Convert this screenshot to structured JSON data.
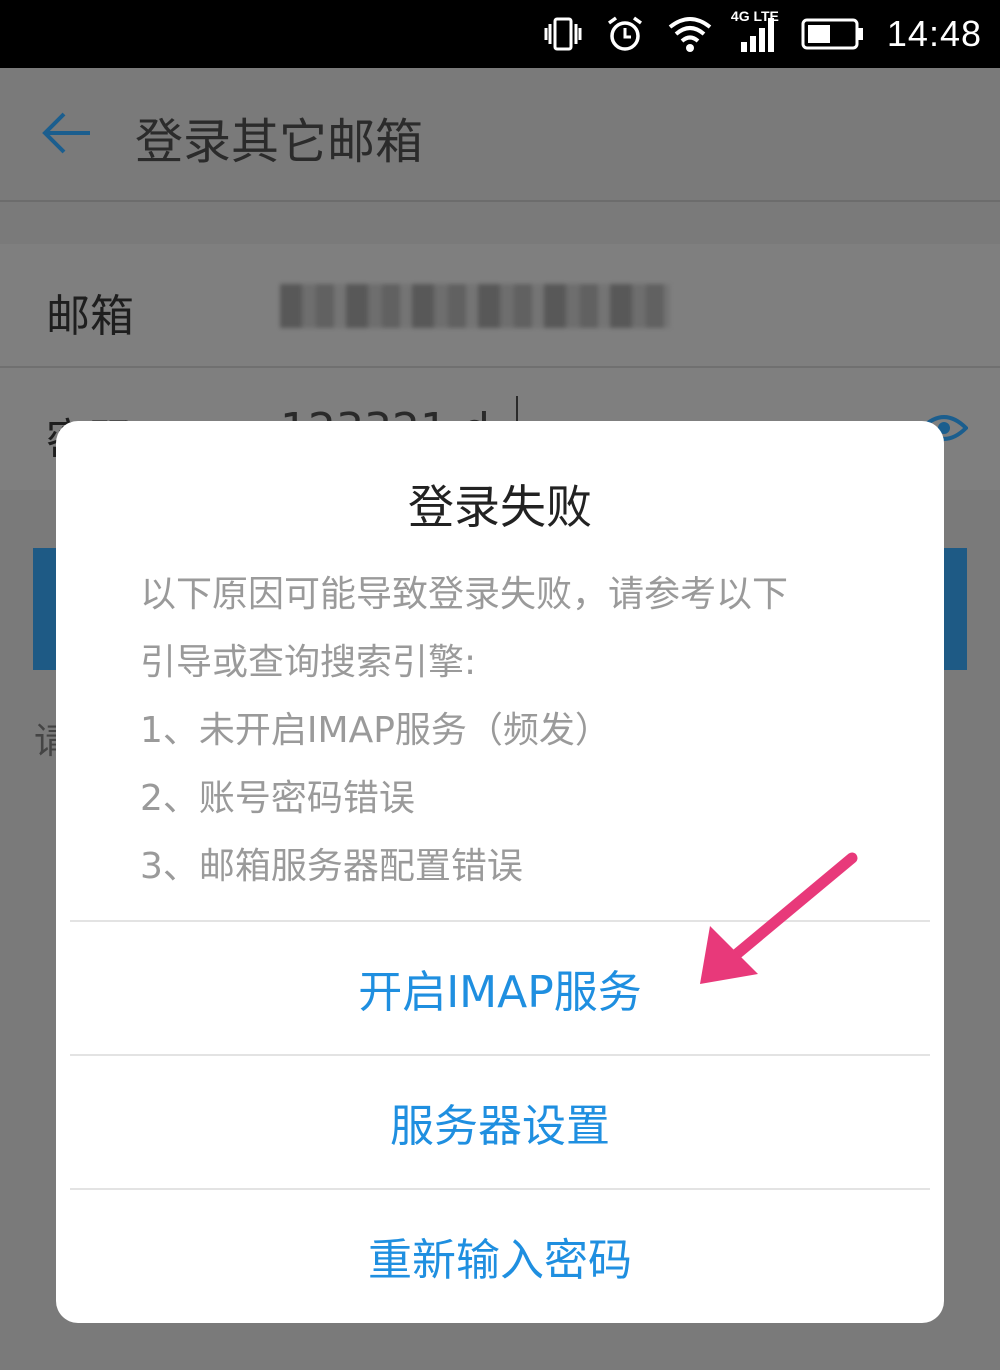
{
  "status_bar": {
    "network_label": "4G LTE",
    "time": "14:48"
  },
  "header": {
    "title": "登录其它邮箱"
  },
  "form": {
    "email_label": "邮箱",
    "password_label": "密码",
    "password_value": "123321.d"
  },
  "hint_text": "请",
  "dialog": {
    "title": "登录失败",
    "body_lines": [
      "以下原因可能导致登录失败，请参考以下",
      "引导或查询搜索引擎:",
      "1、未开启IMAP服务（频发）",
      "2、账号密码错误",
      "3、邮箱服务器配置错误"
    ],
    "buttons": {
      "enable_imap": "开启IMAP服务",
      "server_settings": "服务器设置",
      "reenter_password": "重新输入密码"
    }
  },
  "colors": {
    "accent_blue": "#1f8fe0",
    "annotation_pink": "#e8397a"
  }
}
